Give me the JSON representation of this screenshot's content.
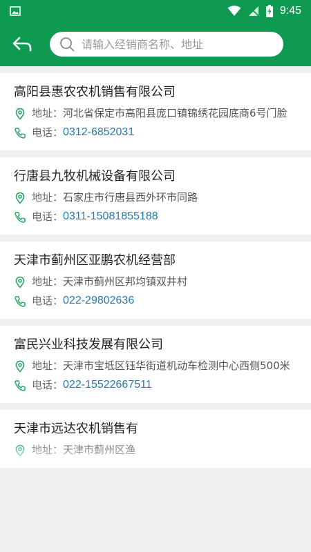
{
  "status_bar": {
    "time": "9:45"
  },
  "search": {
    "placeholder": "请输入经销商名称、地址"
  },
  "dealers": [
    {
      "name": "高阳县惠农农机销售有限公司",
      "address_label": "地址：",
      "address": "河北省保定市高阳县庞口镇锦绣花园底商6号门脸",
      "phone_label": "电话：",
      "phone": "0312-6852031"
    },
    {
      "name": "行唐县九牧机械设备有限公司",
      "address_label": "地址：",
      "address": "石家庄市行唐县西外环市同路",
      "phone_label": "电话：",
      "phone": "0311-15081855188"
    },
    {
      "name": "天津市蓟州区亚鹏农机经营部",
      "address_label": "地址：",
      "address": "天津市蓟州区邦均镇双井村",
      "phone_label": "电话：",
      "phone": "022-29802636"
    },
    {
      "name": "富民兴业科技发展有限公司",
      "address_label": "地址：",
      "address": "天津市宝坻区钰华街道机动车检测中心西侧500米",
      "phone_label": "电话：",
      "phone": "022-15522667511"
    },
    {
      "name": "天津市远达农机销售有",
      "address_label": "地址：",
      "address": "天津市蓟州区渔"
    }
  ],
  "colors": {
    "brand_green": "#0f9a52",
    "icon_green": "#1aa35e",
    "phone_blue": "#1e7ab0"
  }
}
